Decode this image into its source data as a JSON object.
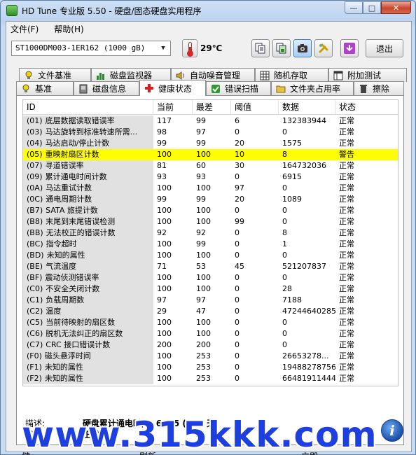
{
  "window": {
    "title": "HD Tune 专业版 5.50 - 硬盘/固态硬盘实用程序",
    "minimize_glyph": "—",
    "maximize_glyph": "□",
    "close_glyph": "✕"
  },
  "menu": {
    "file": "文件(F)",
    "help": "帮助(H)"
  },
  "toolbar": {
    "drive": "ST1000DM003-1ER162 (1000 gB)",
    "temperature": "29℃",
    "exit_label": "退出",
    "buttons": [
      "copy-text-icon",
      "copy-screenshot-icon",
      "camera-icon",
      "settings-icon",
      "save-icon"
    ]
  },
  "tabs": {
    "row1": [
      "文件基准",
      "磁盘监视器",
      "自动噪音管理",
      "随机存取",
      "附加测试"
    ],
    "row2": [
      "基准",
      "磁盘信息",
      "健康状态",
      "错误扫描",
      "文件夹占用率",
      "擦除"
    ],
    "selected": "健康状态"
  },
  "table": {
    "headers": {
      "id": "ID",
      "current": "当前",
      "worst": "最差",
      "threshold": "阈值",
      "data": "数据",
      "status": "状态"
    },
    "rows": [
      {
        "code": "(01)",
        "name": "底层数据读取错误率",
        "current": "117",
        "worst": "99",
        "threshold": "6",
        "data": "132383944",
        "status": "正常"
      },
      {
        "code": "(03)",
        "name": "马达旋转到标准转速所需...",
        "current": "98",
        "worst": "97",
        "threshold": "0",
        "data": "0",
        "status": "正常"
      },
      {
        "code": "(04)",
        "name": "马达启动/停止计数",
        "current": "99",
        "worst": "99",
        "threshold": "20",
        "data": "1575",
        "status": "正常"
      },
      {
        "code": "(05)",
        "name": "重映射扇区计数",
        "current": "100",
        "worst": "100",
        "threshold": "10",
        "data": "8",
        "status": "警告"
      },
      {
        "code": "(07)",
        "name": "寻道错误率",
        "current": "81",
        "worst": "60",
        "threshold": "30",
        "data": "164732036",
        "status": "正常"
      },
      {
        "code": "(09)",
        "name": "累计通电时间计数",
        "current": "93",
        "worst": "93",
        "threshold": "0",
        "data": "6915",
        "status": "正常"
      },
      {
        "code": "(0A)",
        "name": "马达重试计数",
        "current": "100",
        "worst": "100",
        "threshold": "97",
        "data": "0",
        "status": "正常"
      },
      {
        "code": "(0C)",
        "name": "通电周期计数",
        "current": "99",
        "worst": "99",
        "threshold": "20",
        "data": "1089",
        "status": "正常"
      },
      {
        "code": "(B7)",
        "name": "SATA 旅提计数",
        "current": "100",
        "worst": "100",
        "threshold": "0",
        "data": "0",
        "status": "正常"
      },
      {
        "code": "(B8)",
        "name": "末尾到末尾错误检测",
        "current": "100",
        "worst": "100",
        "threshold": "99",
        "data": "0",
        "status": "正常"
      },
      {
        "code": "(BB)",
        "name": "无法校正的错误计数",
        "current": "92",
        "worst": "92",
        "threshold": "0",
        "data": "8",
        "status": "正常"
      },
      {
        "code": "(BC)",
        "name": "指令超时",
        "current": "100",
        "worst": "99",
        "threshold": "0",
        "data": "1",
        "status": "正常"
      },
      {
        "code": "(BD)",
        "name": "未知的属性",
        "current": "100",
        "worst": "100",
        "threshold": "0",
        "data": "0",
        "status": "正常"
      },
      {
        "code": "(BE)",
        "name": "气流温度",
        "current": "71",
        "worst": "53",
        "threshold": "45",
        "data": "521207837",
        "status": "正常"
      },
      {
        "code": "(BF)",
        "name": "震动侦测错误率",
        "current": "100",
        "worst": "100",
        "threshold": "0",
        "data": "0",
        "status": "正常"
      },
      {
        "code": "(C0)",
        "name": "不安全关闭计数",
        "current": "100",
        "worst": "100",
        "threshold": "0",
        "data": "28",
        "status": "正常"
      },
      {
        "code": "(C1)",
        "name": "负载周期数",
        "current": "97",
        "worst": "97",
        "threshold": "0",
        "data": "7188",
        "status": "正常"
      },
      {
        "code": "(C2)",
        "name": "温度",
        "current": "29",
        "worst": "47",
        "threshold": "0",
        "data": "47244640285",
        "status": "正常"
      },
      {
        "code": "(C5)",
        "name": "当前待映射的扇区数",
        "current": "100",
        "worst": "100",
        "threshold": "0",
        "data": "0",
        "status": "正常"
      },
      {
        "code": "(C6)",
        "name": "脱机无法纠正的扇区数",
        "current": "100",
        "worst": "100",
        "threshold": "0",
        "data": "0",
        "status": "正常"
      },
      {
        "code": "(C7)",
        "name": "CRC 接口错误计数",
        "current": "200",
        "worst": "200",
        "threshold": "0",
        "data": "0",
        "status": "正常"
      },
      {
        "code": "(F0)",
        "name": "磁头悬浮时间",
        "current": "100",
        "worst": "253",
        "threshold": "0",
        "data": "26653278...",
        "status": "正常"
      },
      {
        "code": "(F1)",
        "name": "未知的属性",
        "current": "100",
        "worst": "253",
        "threshold": "0",
        "data": "19488278756",
        "status": "正常"
      },
      {
        "code": "(F2)",
        "name": "未知的属性",
        "current": "100",
        "worst": "253",
        "threshold": "0",
        "data": "66481911444",
        "status": "正常"
      }
    ]
  },
  "details": {
    "description_label": "描述:",
    "description_value": "硬盘累计通电时间: 6915 (288 天)",
    "status_label": "状态:",
    "status_value": "正常"
  },
  "bottom": {
    "left": "健",
    "middle": "刷新",
    "right": "立即"
  },
  "watermark": "www.315kkk.com",
  "colors": {
    "warning_row": "#ffff00",
    "id_column_bg": "#e1e1e1",
    "selected_tab_icon": "#d81e1e",
    "watermark": "#1d3fe0"
  }
}
